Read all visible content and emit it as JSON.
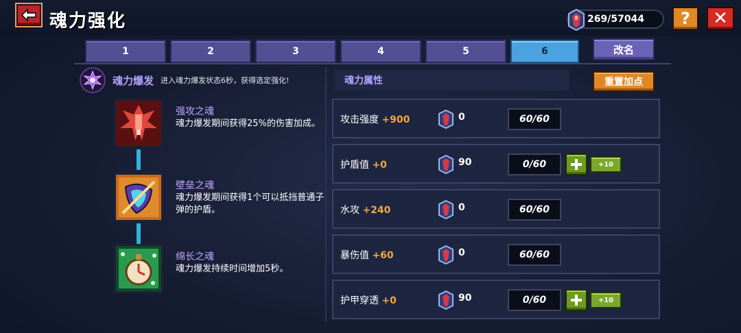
{
  "header": {
    "title": "魂力强化",
    "currency": "269/57044"
  },
  "tabs": [
    {
      "label": "1"
    },
    {
      "label": "2"
    },
    {
      "label": "3"
    },
    {
      "label": "4"
    },
    {
      "label": "5"
    },
    {
      "label": "6",
      "active": true
    }
  ],
  "rename_label": "改名",
  "burst": {
    "title": "魂力爆发",
    "desc": "进入魂力爆发状态6秒，获得选定强化!"
  },
  "skills": [
    {
      "name": "强攻之魂",
      "desc": "魂力爆发期间获得25%的伤害加成。"
    },
    {
      "name": "壁垒之魂",
      "desc": "魂力爆发期间获得1个可以抵挡普通子弹的护盾。"
    },
    {
      "name": "绵长之魂",
      "desc": "魂力爆发持续时间增加5秒。"
    }
  ],
  "attributes_title": "魂力属性",
  "reset_label": "重置加点",
  "attributes": [
    {
      "name": "攻击强度",
      "bonus": "+900",
      "cost": "0",
      "level": "60/60"
    },
    {
      "name": "护盾值",
      "bonus": "+0",
      "cost": "90",
      "level": "0/60",
      "plus10": "+10"
    },
    {
      "name": "水攻",
      "bonus": "+240",
      "cost": "0",
      "level": "60/60"
    },
    {
      "name": "暴伤值",
      "bonus": "+60",
      "cost": "0",
      "level": "60/60"
    },
    {
      "name": "护甲穿透",
      "bonus": "+0",
      "cost": "90",
      "level": "0/60",
      "plus10": "+10"
    }
  ],
  "colors": {
    "accent_purple": "#b5a2ff",
    "bonus_orange": "#f2a93b",
    "tab_active": "#4aa3e0"
  }
}
